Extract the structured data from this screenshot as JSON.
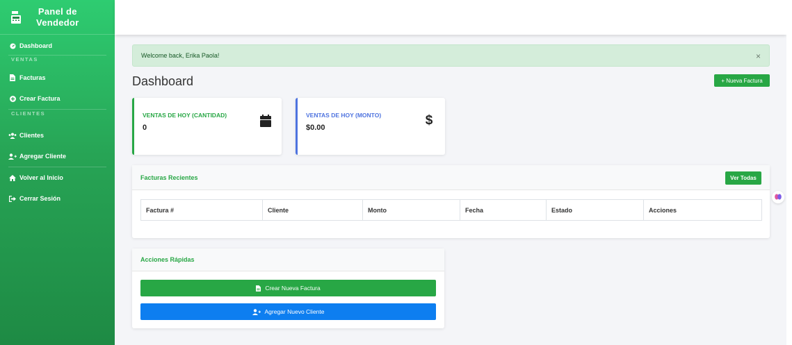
{
  "sidebar": {
    "brand_line1": "Panel de",
    "brand_line2": "Vendedor",
    "items": {
      "dashboard": "Dashboard",
      "ventas_head": "VENTAS",
      "facturas": "Facturas",
      "crear_factura": "Crear Factura",
      "clientes_head": "CLIENTES",
      "clientes": "Clientes",
      "agregar_cliente": "Agregar Cliente",
      "volver": "Volver al Inicio",
      "cerrar": "Cerrar Sesión"
    }
  },
  "alert": {
    "message": "Welcome back, Erika Paola!",
    "close": "×"
  },
  "page": {
    "title": "Dashboard",
    "new_invoice_btn": "+ Nueva Factura"
  },
  "stats": {
    "count_label": "VENTAS DE HOY (CANTIDAD)",
    "count_value": "0",
    "amount_label": "VENTAS DE HOY (MONTO)",
    "amount_value": "$0.00",
    "colors": {
      "green": "#28a745",
      "blue": "#4e73df"
    }
  },
  "recent": {
    "title": "Facturas Recientes",
    "view_all": "Ver Todas",
    "columns": [
      "Factura #",
      "Cliente",
      "Monto",
      "Fecha",
      "Estado",
      "Acciones"
    ]
  },
  "quick": {
    "title": "Acciones Rápidas",
    "new_invoice": "Crear Nueva Factura",
    "new_client": "Agregar Nuevo Cliente"
  },
  "icons": [
    "cash-register-icon",
    "dashboard-icon",
    "file-invoice-icon",
    "plus-circle-icon",
    "users-icon",
    "user-plus-icon",
    "home-icon",
    "sign-out-icon",
    "calendar-icon",
    "dollar-icon",
    "brain-icon"
  ]
}
